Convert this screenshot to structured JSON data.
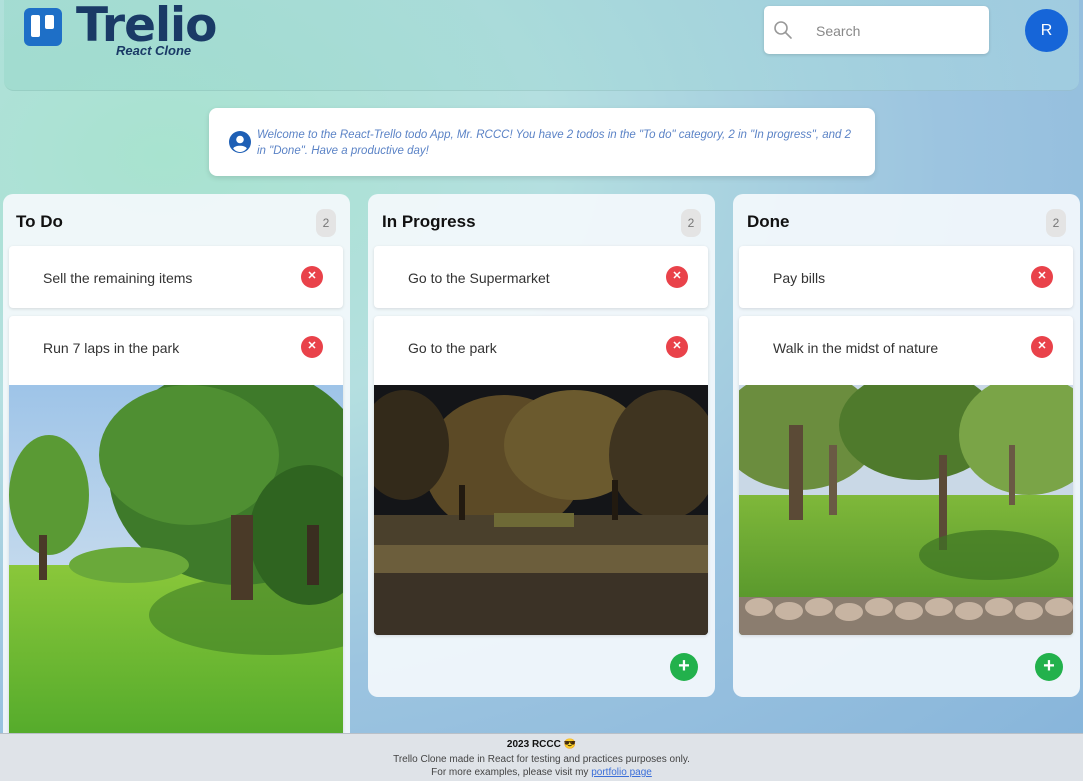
{
  "app": {
    "logo_text": "Trelio",
    "logo_subtitle": "React Clone"
  },
  "header": {
    "search_placeholder": "Search",
    "avatar_initial": "R"
  },
  "welcome": {
    "message": "Welcome to the React-Trello todo App, Mr. RCCC! You have 2 todos in the \"To do\" category, 2 in \"In progress\", and 2 in \"Done\". Have a productive day!"
  },
  "columns": [
    {
      "title": "To Do",
      "count": "2",
      "cards": [
        {
          "text": "Sell the remaining items",
          "delete_icon": "x-icon"
        },
        {
          "text": "Run 7 laps in the park",
          "delete_icon": "x-icon",
          "image": "park-daytime-photo"
        }
      ]
    },
    {
      "title": "In Progress",
      "count": "2",
      "cards": [
        {
          "text": "Go to the Supermarket",
          "delete_icon": "x-icon"
        },
        {
          "text": "Go to the park",
          "delete_icon": "x-icon",
          "image": "park-night-photo"
        }
      ],
      "add_icon": "plus-icon"
    },
    {
      "title": "Done",
      "count": "2",
      "cards": [
        {
          "text": "Pay bills",
          "delete_icon": "x-icon"
        },
        {
          "text": "Walk in the midst of nature",
          "delete_icon": "x-icon",
          "image": "nature-trees-photo"
        }
      ],
      "add_icon": "plus-icon"
    }
  ],
  "footer": {
    "title": "2023 RCCC 😎",
    "line1": "Trello Clone made in React for testing and practices purposes only.",
    "line2_prefix": "For more examples, please visit my ",
    "link_text": "portfolio page"
  },
  "colors": {
    "brand_blue": "#1e6fc7",
    "avatar_blue": "#1665d8",
    "delete_red": "#e9424a",
    "add_green": "#22b14c"
  }
}
